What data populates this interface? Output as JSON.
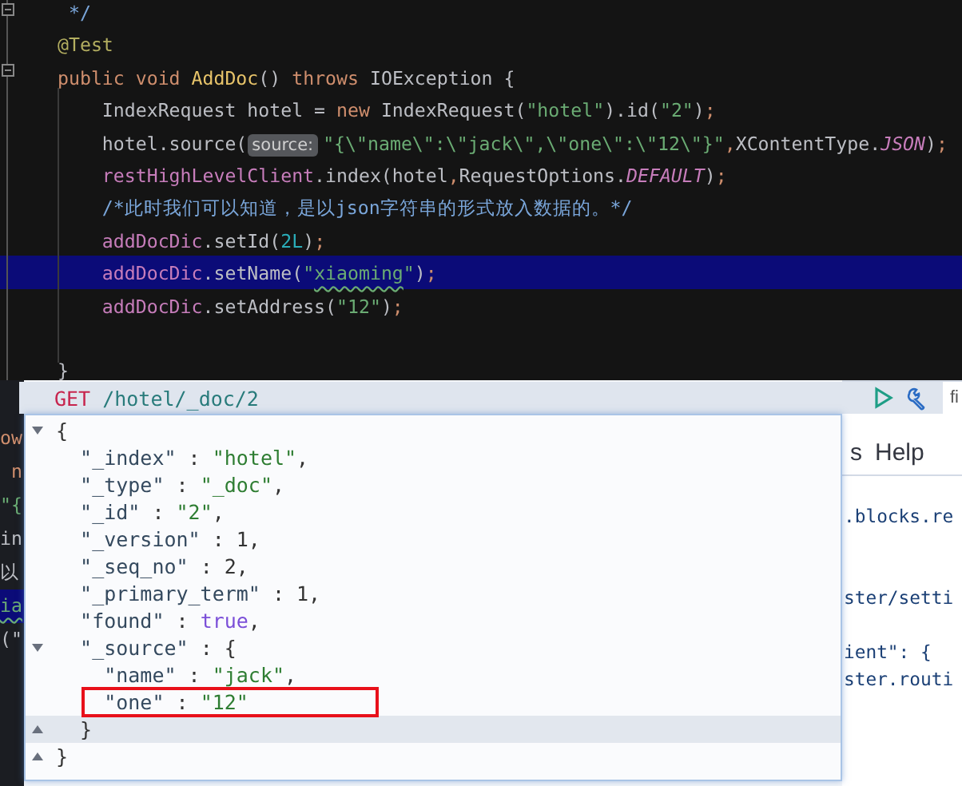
{
  "editor": {
    "lines": [
      {
        "highlighted": false,
        "tokens": [
          {
            "kind": "comment",
            "text": " */"
          }
        ]
      },
      {
        "highlighted": false,
        "tokens": [
          {
            "kind": "ann",
            "text": "@Test"
          }
        ]
      },
      {
        "highlighted": false,
        "tokens": [
          {
            "kind": "kw",
            "text": "public void "
          },
          {
            "kind": "fn",
            "text": "AddDoc"
          },
          {
            "kind": "plain",
            "text": "() "
          },
          {
            "kind": "kw",
            "text": "throws "
          },
          {
            "kind": "plain",
            "text": "IOException {"
          }
        ]
      },
      {
        "highlighted": false,
        "tokens": [
          {
            "kind": "plain",
            "text": "    IndexRequest hotel = "
          },
          {
            "kind": "kw",
            "text": "new "
          },
          {
            "kind": "plain",
            "text": "IndexRequest("
          },
          {
            "kind": "str",
            "text": "\"hotel\""
          },
          {
            "kind": "plain",
            "text": ").id("
          },
          {
            "kind": "str",
            "text": "\"2\""
          },
          {
            "kind": "plain",
            "text": ")"
          },
          {
            "kind": "kw",
            "text": ";"
          }
        ]
      },
      {
        "highlighted": false,
        "tokens": [
          {
            "kind": "plain",
            "text": "    hotel.source("
          },
          {
            "kind": "hint",
            "text": "source:"
          },
          {
            "kind": "str",
            "text": "\"{\\\"name\\\":\\\"jack\\\",\\\"one\\\":\\\"12\\\"}\""
          },
          {
            "kind": "kw",
            "text": ","
          },
          {
            "kind": "plain",
            "text": "XContentType."
          },
          {
            "kind": "const",
            "text": "JSON"
          },
          {
            "kind": "plain",
            "text": ")"
          },
          {
            "kind": "kw",
            "text": ";"
          }
        ]
      },
      {
        "highlighted": false,
        "tokens": [
          {
            "kind": "field",
            "text": "    restHighLevelClient"
          },
          {
            "kind": "plain",
            "text": ".index(hotel"
          },
          {
            "kind": "kw",
            "text": ","
          },
          {
            "kind": "plain",
            "text": "RequestOptions."
          },
          {
            "kind": "const",
            "text": "DEFAULT"
          },
          {
            "kind": "plain",
            "text": ")"
          },
          {
            "kind": "kw",
            "text": ";"
          }
        ]
      },
      {
        "highlighted": false,
        "tokens": [
          {
            "kind": "comment",
            "text": "    /*此时我们可以知道，是以json字符串的形式放入数据的。*/"
          }
        ]
      },
      {
        "highlighted": false,
        "tokens": [
          {
            "kind": "field",
            "text": "    addDocDic"
          },
          {
            "kind": "plain",
            "text": ".setId("
          },
          {
            "kind": "num",
            "text": "2L"
          },
          {
            "kind": "plain",
            "text": ")"
          },
          {
            "kind": "kw",
            "text": ";"
          }
        ]
      },
      {
        "highlighted": true,
        "tokens": [
          {
            "kind": "field",
            "text": "    addDocDic"
          },
          {
            "kind": "plain",
            "text": ".setName("
          },
          {
            "kind": "str",
            "text": "\""
          },
          {
            "kind": "typo",
            "text": "xiaoming"
          },
          {
            "kind": "str",
            "text": "\""
          },
          {
            "kind": "plain",
            "text": ")"
          },
          {
            "kind": "kw",
            "text": ";"
          }
        ]
      },
      {
        "highlighted": false,
        "tokens": [
          {
            "kind": "field",
            "text": "    addDocDic"
          },
          {
            "kind": "plain",
            "text": ".setAddress("
          },
          {
            "kind": "str",
            "text": "\"12\""
          },
          {
            "kind": "plain",
            "text": ")"
          },
          {
            "kind": "kw",
            "text": ";"
          }
        ]
      },
      {
        "highlighted": false
      },
      {
        "highlighted": false,
        "tokens": [
          {
            "kind": "plain",
            "text": "}"
          }
        ]
      }
    ]
  },
  "background_editor_fragments": [
    {
      "text": "ow",
      "kind": "kw",
      "highlighted": false
    },
    {
      "text": " n",
      "kind": "kw",
      "highlighted": false
    },
    {
      "text": "\"{",
      "kind": "str",
      "highlighted": false
    },
    {
      "text": "in",
      "kind": "plain",
      "highlighted": false
    },
    {
      "text": "以",
      "kind": "plain",
      "highlighted": false
    },
    {
      "text": "ia",
      "kind": "typo",
      "highlighted": true
    },
    {
      "text": "(\"",
      "kind": "plain",
      "highlighted": false
    }
  ],
  "request_bar": {
    "method": "GET",
    "path": "/hotel/_doc/2"
  },
  "response": {
    "lines": [
      {
        "fold_start": true,
        "fold_end": false,
        "highlighted": false,
        "boxed": false,
        "tokens": [
          {
            "kind": "punct",
            "text": "{"
          }
        ]
      },
      {
        "fold_start": false,
        "fold_end": false,
        "highlighted": false,
        "boxed": false,
        "tokens": [
          {
            "kind": "key",
            "text": "  \"_index\""
          },
          {
            "kind": "punct",
            "text": " : "
          },
          {
            "kind": "string",
            "text": "\"hotel\""
          },
          {
            "kind": "punct",
            "text": ","
          }
        ]
      },
      {
        "fold_start": false,
        "fold_end": false,
        "highlighted": false,
        "boxed": false,
        "tokens": [
          {
            "kind": "key",
            "text": "  \"_type\""
          },
          {
            "kind": "punct",
            "text": " : "
          },
          {
            "kind": "string",
            "text": "\"_doc\""
          },
          {
            "kind": "punct",
            "text": ","
          }
        ]
      },
      {
        "fold_start": false,
        "fold_end": false,
        "highlighted": false,
        "boxed": false,
        "tokens": [
          {
            "kind": "key",
            "text": "  \"_id\""
          },
          {
            "kind": "punct",
            "text": " : "
          },
          {
            "kind": "string",
            "text": "\"2\""
          },
          {
            "kind": "punct",
            "text": ","
          }
        ]
      },
      {
        "fold_start": false,
        "fold_end": false,
        "highlighted": false,
        "boxed": false,
        "tokens": [
          {
            "kind": "key",
            "text": "  \"_version\""
          },
          {
            "kind": "punct",
            "text": " : 1,"
          }
        ]
      },
      {
        "fold_start": false,
        "fold_end": false,
        "highlighted": false,
        "boxed": false,
        "tokens": [
          {
            "kind": "key",
            "text": "  \"_seq_no\""
          },
          {
            "kind": "punct",
            "text": " : 2,"
          }
        ]
      },
      {
        "fold_start": false,
        "fold_end": false,
        "highlighted": false,
        "boxed": false,
        "tokens": [
          {
            "kind": "key",
            "text": "  \"_primary_term\""
          },
          {
            "kind": "punct",
            "text": " : 1,"
          }
        ]
      },
      {
        "fold_start": false,
        "fold_end": false,
        "highlighted": false,
        "boxed": false,
        "tokens": [
          {
            "kind": "key",
            "text": "  \"found\""
          },
          {
            "kind": "punct",
            "text": " : "
          },
          {
            "kind": "bool",
            "text": "true"
          },
          {
            "kind": "punct",
            "text": ","
          }
        ]
      },
      {
        "fold_start": true,
        "fold_end": false,
        "highlighted": false,
        "boxed": false,
        "tokens": [
          {
            "kind": "key",
            "text": "  \"_source\""
          },
          {
            "kind": "punct",
            "text": " : {"
          }
        ]
      },
      {
        "fold_start": false,
        "fold_end": false,
        "highlighted": false,
        "boxed": false,
        "tokens": [
          {
            "kind": "key",
            "text": "    \"name\""
          },
          {
            "kind": "punct",
            "text": " : "
          },
          {
            "kind": "string",
            "text": "\"jack\""
          },
          {
            "kind": "punct",
            "text": ","
          }
        ]
      },
      {
        "fold_start": false,
        "fold_end": false,
        "highlighted": false,
        "boxed": true,
        "tokens": [
          {
            "kind": "key",
            "text": "    \"one\""
          },
          {
            "kind": "punct",
            "text": " : "
          },
          {
            "kind": "string",
            "text": "\"12\""
          }
        ]
      },
      {
        "fold_start": false,
        "fold_end": true,
        "highlighted": true,
        "boxed": false,
        "tokens": [
          {
            "kind": "punct",
            "text": "  }"
          }
        ]
      },
      {
        "fold_start": false,
        "fold_end": true,
        "highlighted": false,
        "boxed": false,
        "tokens": [
          {
            "kind": "punct",
            "text": "}"
          }
        ]
      }
    ]
  },
  "background_console": {
    "tab_fragment": "fi",
    "menu": [
      "s",
      "Help"
    ],
    "code_fragments": [
      ".blocks.re",
      "ster/setti",
      "ient\": {",
      "ster.routi"
    ]
  }
}
